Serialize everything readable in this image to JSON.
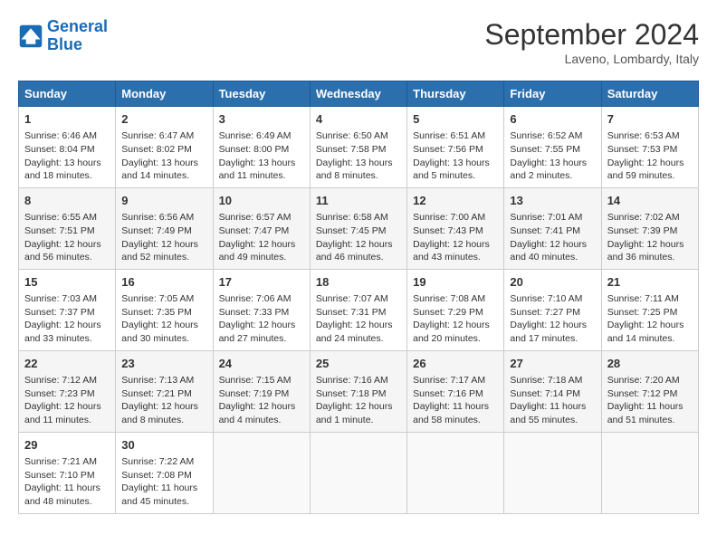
{
  "header": {
    "logo_line1": "General",
    "logo_line2": "Blue",
    "month": "September 2024",
    "location": "Laveno, Lombardy, Italy"
  },
  "days_of_week": [
    "Sunday",
    "Monday",
    "Tuesday",
    "Wednesday",
    "Thursday",
    "Friday",
    "Saturday"
  ],
  "weeks": [
    [
      {
        "day": "1",
        "lines": [
          "Sunrise: 6:46 AM",
          "Sunset: 8:04 PM",
          "Daylight: 13 hours",
          "and 18 minutes."
        ]
      },
      {
        "day": "2",
        "lines": [
          "Sunrise: 6:47 AM",
          "Sunset: 8:02 PM",
          "Daylight: 13 hours",
          "and 14 minutes."
        ]
      },
      {
        "day": "3",
        "lines": [
          "Sunrise: 6:49 AM",
          "Sunset: 8:00 PM",
          "Daylight: 13 hours",
          "and 11 minutes."
        ]
      },
      {
        "day": "4",
        "lines": [
          "Sunrise: 6:50 AM",
          "Sunset: 7:58 PM",
          "Daylight: 13 hours",
          "and 8 minutes."
        ]
      },
      {
        "day": "5",
        "lines": [
          "Sunrise: 6:51 AM",
          "Sunset: 7:56 PM",
          "Daylight: 13 hours",
          "and 5 minutes."
        ]
      },
      {
        "day": "6",
        "lines": [
          "Sunrise: 6:52 AM",
          "Sunset: 7:55 PM",
          "Daylight: 13 hours",
          "and 2 minutes."
        ]
      },
      {
        "day": "7",
        "lines": [
          "Sunrise: 6:53 AM",
          "Sunset: 7:53 PM",
          "Daylight: 12 hours",
          "and 59 minutes."
        ]
      }
    ],
    [
      {
        "day": "8",
        "lines": [
          "Sunrise: 6:55 AM",
          "Sunset: 7:51 PM",
          "Daylight: 12 hours",
          "and 56 minutes."
        ]
      },
      {
        "day": "9",
        "lines": [
          "Sunrise: 6:56 AM",
          "Sunset: 7:49 PM",
          "Daylight: 12 hours",
          "and 52 minutes."
        ]
      },
      {
        "day": "10",
        "lines": [
          "Sunrise: 6:57 AM",
          "Sunset: 7:47 PM",
          "Daylight: 12 hours",
          "and 49 minutes."
        ]
      },
      {
        "day": "11",
        "lines": [
          "Sunrise: 6:58 AM",
          "Sunset: 7:45 PM",
          "Daylight: 12 hours",
          "and 46 minutes."
        ]
      },
      {
        "day": "12",
        "lines": [
          "Sunrise: 7:00 AM",
          "Sunset: 7:43 PM",
          "Daylight: 12 hours",
          "and 43 minutes."
        ]
      },
      {
        "day": "13",
        "lines": [
          "Sunrise: 7:01 AM",
          "Sunset: 7:41 PM",
          "Daylight: 12 hours",
          "and 40 minutes."
        ]
      },
      {
        "day": "14",
        "lines": [
          "Sunrise: 7:02 AM",
          "Sunset: 7:39 PM",
          "Daylight: 12 hours",
          "and 36 minutes."
        ]
      }
    ],
    [
      {
        "day": "15",
        "lines": [
          "Sunrise: 7:03 AM",
          "Sunset: 7:37 PM",
          "Daylight: 12 hours",
          "and 33 minutes."
        ]
      },
      {
        "day": "16",
        "lines": [
          "Sunrise: 7:05 AM",
          "Sunset: 7:35 PM",
          "Daylight: 12 hours",
          "and 30 minutes."
        ]
      },
      {
        "day": "17",
        "lines": [
          "Sunrise: 7:06 AM",
          "Sunset: 7:33 PM",
          "Daylight: 12 hours",
          "and 27 minutes."
        ]
      },
      {
        "day": "18",
        "lines": [
          "Sunrise: 7:07 AM",
          "Sunset: 7:31 PM",
          "Daylight: 12 hours",
          "and 24 minutes."
        ]
      },
      {
        "day": "19",
        "lines": [
          "Sunrise: 7:08 AM",
          "Sunset: 7:29 PM",
          "Daylight: 12 hours",
          "and 20 minutes."
        ]
      },
      {
        "day": "20",
        "lines": [
          "Sunrise: 7:10 AM",
          "Sunset: 7:27 PM",
          "Daylight: 12 hours",
          "and 17 minutes."
        ]
      },
      {
        "day": "21",
        "lines": [
          "Sunrise: 7:11 AM",
          "Sunset: 7:25 PM",
          "Daylight: 12 hours",
          "and 14 minutes."
        ]
      }
    ],
    [
      {
        "day": "22",
        "lines": [
          "Sunrise: 7:12 AM",
          "Sunset: 7:23 PM",
          "Daylight: 12 hours",
          "and 11 minutes."
        ]
      },
      {
        "day": "23",
        "lines": [
          "Sunrise: 7:13 AM",
          "Sunset: 7:21 PM",
          "Daylight: 12 hours",
          "and 8 minutes."
        ]
      },
      {
        "day": "24",
        "lines": [
          "Sunrise: 7:15 AM",
          "Sunset: 7:19 PM",
          "Daylight: 12 hours",
          "and 4 minutes."
        ]
      },
      {
        "day": "25",
        "lines": [
          "Sunrise: 7:16 AM",
          "Sunset: 7:18 PM",
          "Daylight: 12 hours",
          "and 1 minute."
        ]
      },
      {
        "day": "26",
        "lines": [
          "Sunrise: 7:17 AM",
          "Sunset: 7:16 PM",
          "Daylight: 11 hours",
          "and 58 minutes."
        ]
      },
      {
        "day": "27",
        "lines": [
          "Sunrise: 7:18 AM",
          "Sunset: 7:14 PM",
          "Daylight: 11 hours",
          "and 55 minutes."
        ]
      },
      {
        "day": "28",
        "lines": [
          "Sunrise: 7:20 AM",
          "Sunset: 7:12 PM",
          "Daylight: 11 hours",
          "and 51 minutes."
        ]
      }
    ],
    [
      {
        "day": "29",
        "lines": [
          "Sunrise: 7:21 AM",
          "Sunset: 7:10 PM",
          "Daylight: 11 hours",
          "and 48 minutes."
        ]
      },
      {
        "day": "30",
        "lines": [
          "Sunrise: 7:22 AM",
          "Sunset: 7:08 PM",
          "Daylight: 11 hours",
          "and 45 minutes."
        ]
      },
      null,
      null,
      null,
      null,
      null
    ]
  ]
}
